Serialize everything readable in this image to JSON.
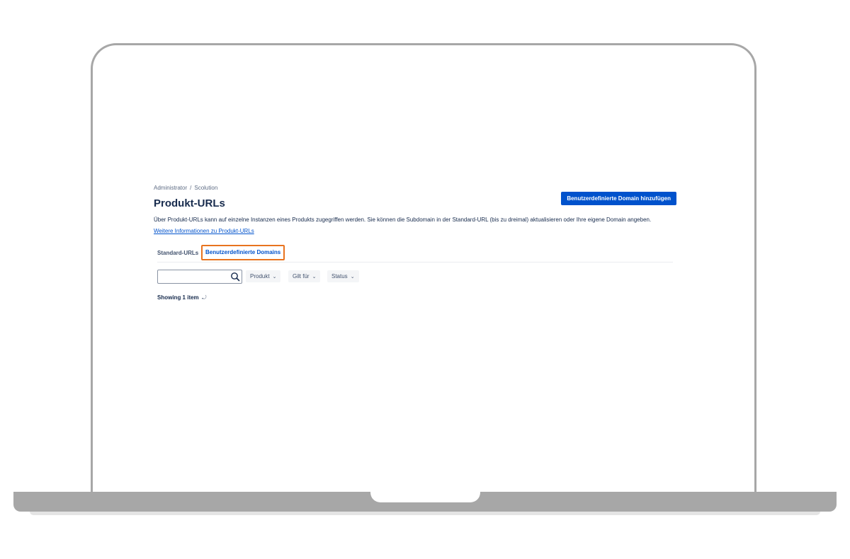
{
  "breadcrumb": {
    "items": [
      "Administrator",
      "Scolution"
    ],
    "separator": "/"
  },
  "page": {
    "title": "Produkt-URLs",
    "description": "Über Produkt-URLs kann auf einzelne Instanzen eines Produkts zugegriffen werden. Sie können die Subdomain in der Standard-URL (bis zu dreimal) aktualisieren oder Ihre eigene Domain angeben.",
    "info_link": "Weitere Informationen zu Produkt-URLs"
  },
  "actions": {
    "add_domain_label": "Benutzerdefinierte Domain hinzufügen"
  },
  "tabs": [
    {
      "label": "Standard-URLs",
      "selected": false
    },
    {
      "label": "Benutzerdefinierte Domains",
      "selected": true
    }
  ],
  "filters": {
    "search_value": "",
    "search_icon": "search-icon",
    "dropdowns": [
      "Produkt",
      "Gilt für",
      "Status"
    ],
    "chevron": "⌄"
  },
  "results": {
    "summary": "Showing 1 item",
    "refresh_icon": "⤾"
  },
  "colors": {
    "primary": "#0052cc",
    "tab_highlight": "#e8731f",
    "frame": "#a7a7a7"
  }
}
